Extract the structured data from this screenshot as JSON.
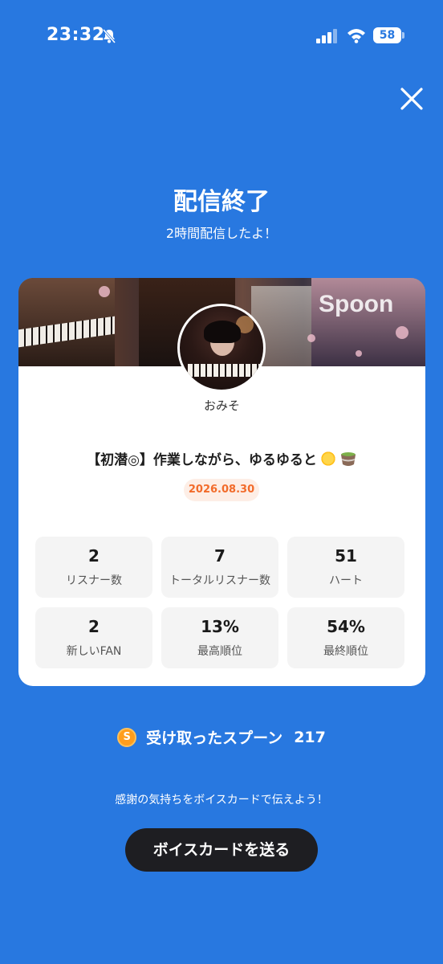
{
  "status_bar": {
    "time": "23:32",
    "battery": "58",
    "icons": [
      "bell-slash-icon",
      "signal-icon",
      "wifi-icon",
      "battery-icon"
    ]
  },
  "header": {
    "close_icon": "close-icon",
    "title": "配信終了",
    "subtitle": "2時間配信したよ！"
  },
  "card": {
    "banner_logo": "Spoon",
    "username": "おみそ",
    "stream_title": "【初潜◎】作業しながら、ゆるゆると",
    "date": "2026.08.30",
    "stats": [
      {
        "value": "2",
        "label": "リスナー数"
      },
      {
        "value": "7",
        "label": "トータルリスナー数"
      },
      {
        "value": "51",
        "label": "ハート"
      },
      {
        "value": "2",
        "label": "新しいFAN"
      },
      {
        "value": "13%",
        "label": "最高順位"
      },
      {
        "value": "54%",
        "label": "最終順位"
      }
    ]
  },
  "spoons": {
    "coin_letter": "S",
    "label": "受け取ったスプーン",
    "count": "217"
  },
  "footer": {
    "thanks": "感謝の気持ちをボイスカードで伝えよう！",
    "button_label": "ボイスカードを送る"
  },
  "colors": {
    "background": "#2878e0",
    "accent_orange": "#f26b2a",
    "coin": "#ff9d1c",
    "button": "#1e1e22"
  }
}
